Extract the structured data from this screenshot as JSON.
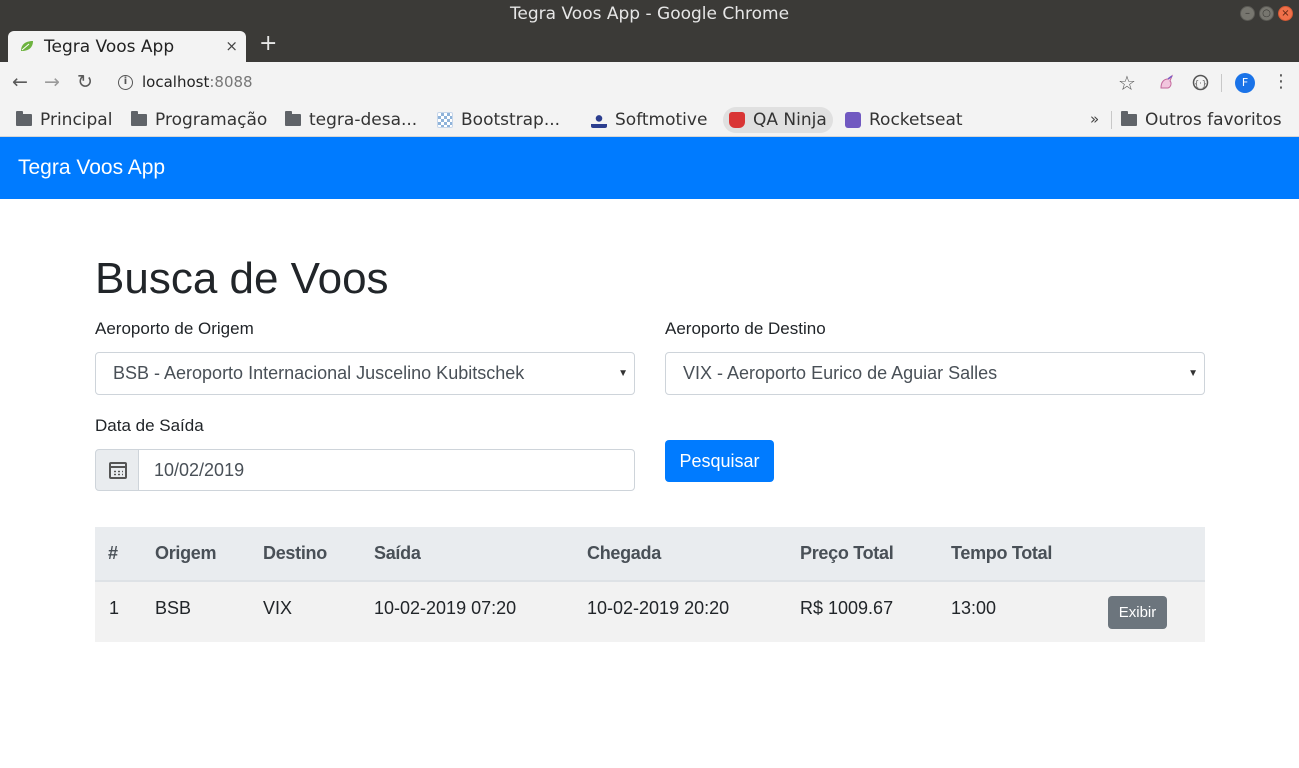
{
  "window": {
    "title": "Tegra Voos App - Google Chrome"
  },
  "tab": {
    "title": "Tegra Voos App",
    "close_glyph": "×"
  },
  "address_bar": {
    "host": "localhost",
    "port": ":8088"
  },
  "bookmarks": {
    "items": [
      {
        "label": "Principal",
        "icon": "folder-icon"
      },
      {
        "label": "Programação",
        "icon": "folder-icon"
      },
      {
        "label": "tegra-desa...",
        "icon": "folder-icon"
      },
      {
        "label": "Bootstrap...",
        "icon": "bootstrap-favicon"
      },
      {
        "label": "Softmotive",
        "icon": "softmotive-favicon"
      },
      {
        "label": "QA Ninja",
        "icon": "qaninja-favicon"
      },
      {
        "label": "Rocketseat",
        "icon": "rocketseat-favicon"
      }
    ],
    "more_glyph": "»",
    "other": {
      "label": "Outros favoritos",
      "icon": "folder-icon"
    }
  },
  "profile": {
    "initial": "F"
  },
  "navbar": {
    "brand": "Tegra Voos App",
    "color": "#007bff"
  },
  "page": {
    "title": "Busca de Voos",
    "origin": {
      "label": "Aeroporto de Origem",
      "selected": "BSB - Aeroporto Internacional Juscelino Kubitschek"
    },
    "destination": {
      "label": "Aeroporto de Destino",
      "selected": "VIX - Aeroporto Eurico de Aguiar Salles"
    },
    "departure_date": {
      "label": "Data de Saída",
      "value": "10/02/2019"
    },
    "search_button": "Pesquisar"
  },
  "results": {
    "headers": [
      "#",
      "Origem",
      "Destino",
      "Saída",
      "Chegada",
      "Preço Total",
      "Tempo Total"
    ],
    "rows": [
      {
        "index": "1",
        "origin": "BSB",
        "destination": "VIX",
        "departure": "10-02-2019 07:20",
        "arrival": "10-02-2019 20:20",
        "price": "R$ 1009.67",
        "duration": "13:00",
        "action": "Exibir"
      }
    ]
  }
}
